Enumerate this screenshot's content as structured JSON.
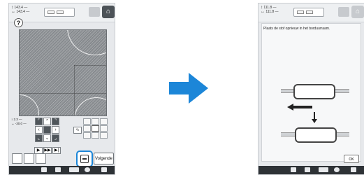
{
  "colors": {
    "accent": "#1c86d8",
    "home": "#4d5358",
    "status_bar": "#2e3236"
  },
  "left_screen": {
    "size_top": "143.4 —",
    "size_bottom": "143.4 —",
    "help_label": "?",
    "coord_y": "2.3 —",
    "coord_x": "-30.0 —",
    "next_button": "Volgende",
    "home_icon": "home-icon"
  },
  "right_screen": {
    "size_top": "111.8 —",
    "size_bottom": "111.8 —",
    "message": "Plaats de stof opnieuw in het borduurraam.",
    "ok_button": "OK"
  },
  "transition_icon": "arrow-right-icon"
}
